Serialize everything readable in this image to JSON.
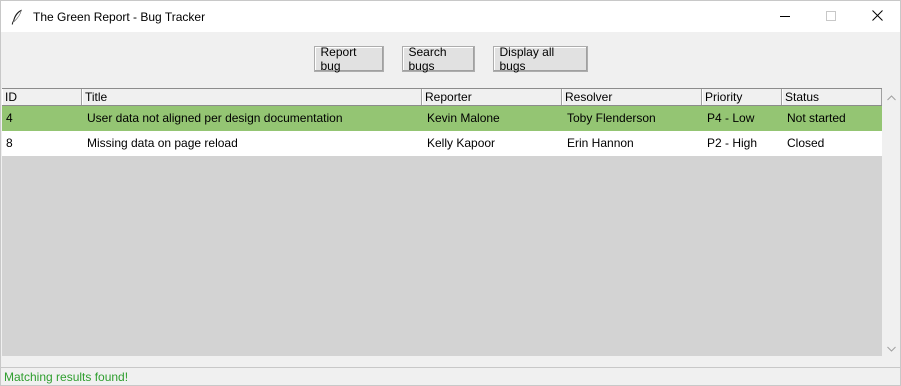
{
  "window": {
    "title": "The Green Report - Bug Tracker"
  },
  "toolbar": {
    "report_label": "Report bug",
    "search_label": "Search bugs",
    "display_label": "Display all bugs"
  },
  "table": {
    "columns": [
      "ID",
      "Title",
      "Reporter",
      "Resolver",
      "Priority",
      "Status"
    ],
    "rows": [
      {
        "id": "4",
        "title": "User data not aligned per design documentation",
        "reporter": "Kevin Malone",
        "resolver": "Toby Flenderson",
        "priority": "P4 - Low",
        "status": "Not started",
        "selected": true
      },
      {
        "id": "8",
        "title": "Missing data on page reload",
        "reporter": "Kelly Kapoor",
        "resolver": "Erin Hannon",
        "priority": "P2 - High",
        "status": "Closed",
        "selected": false
      }
    ]
  },
  "status": {
    "message": "Matching results found!"
  },
  "colors": {
    "selected_row": "#94c573",
    "status_text": "#2e9e2e",
    "table_bg": "#d3d3d3"
  },
  "icons": {
    "app": "feather-icon",
    "minimize": "minimize-icon",
    "maximize": "maximize-icon",
    "close": "close-icon",
    "scroll_up": "chevron-up-icon",
    "scroll_down": "chevron-down-icon"
  }
}
